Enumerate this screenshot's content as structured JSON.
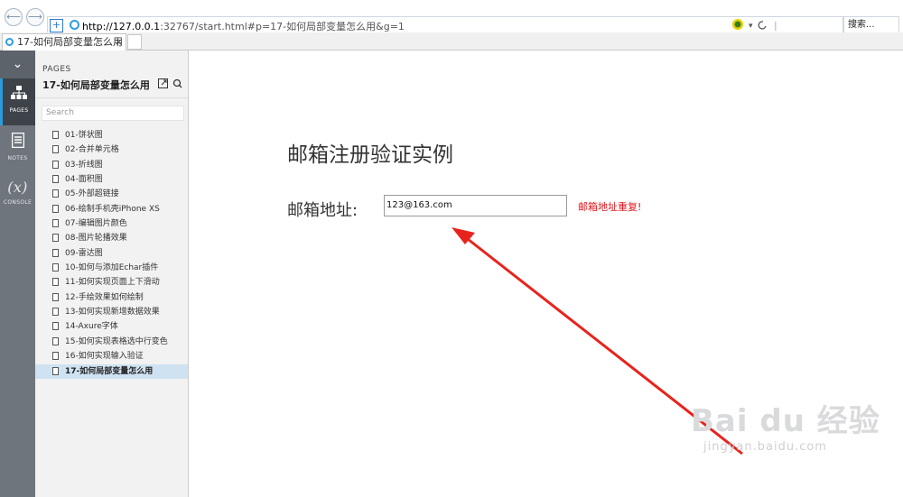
{
  "browser": {
    "url_host": "http://127.0.0.1",
    "url_rest": ":32767/start.html#p=17-如何局部变量怎么用&g=1",
    "refresh_icon": "refresh-icon",
    "search_placeholder": "搜索...",
    "tab_title": "17-如何局部变量怎么用",
    "tab_close": "×"
  },
  "toolstrip": {
    "collapse_glyph": "⌄",
    "items": [
      {
        "label": "PAGES",
        "icon": "sitemap-icon",
        "glyph": "品"
      },
      {
        "label": "NOTES",
        "icon": "notes-icon",
        "glyph": "▤"
      },
      {
        "label": "CONSOLE",
        "icon": "variable-icon",
        "glyph": "(x)"
      }
    ]
  },
  "pages_panel": {
    "label": "PAGES",
    "current_title": "17-如何局部变量怎么用",
    "search_placeholder": "Search",
    "pages": [
      "01-饼状图",
      "02-合并单元格",
      "03-折线图",
      "04-面积图",
      "05-外部超链接",
      "06-绘制手机壳iPhone XS",
      "07-编辑图片颜色",
      "08-图片轮播效果",
      "09-雷达图",
      "10-如何与添加Echar插件",
      "11-如何实现页面上下滑动",
      "12-手绘效果如何绘制",
      "13-如何实现新增数据效果",
      "14-Axure字体",
      "15-如何实现表格选中行变色",
      "16-如何实现输入验证",
      "17-如何局部变量怎么用"
    ],
    "selected_index": 16
  },
  "main": {
    "heading": "邮箱注册验证实例",
    "email_label": "邮箱地址:",
    "email_value": "123@163.com",
    "error_message": "邮箱地址重复!",
    "error_color": "#e3141a",
    "annotation_arrow_color": "#e8231c"
  },
  "watermark": {
    "brand": "Bai du 经验",
    "url": "jingyan.baidu.com"
  }
}
